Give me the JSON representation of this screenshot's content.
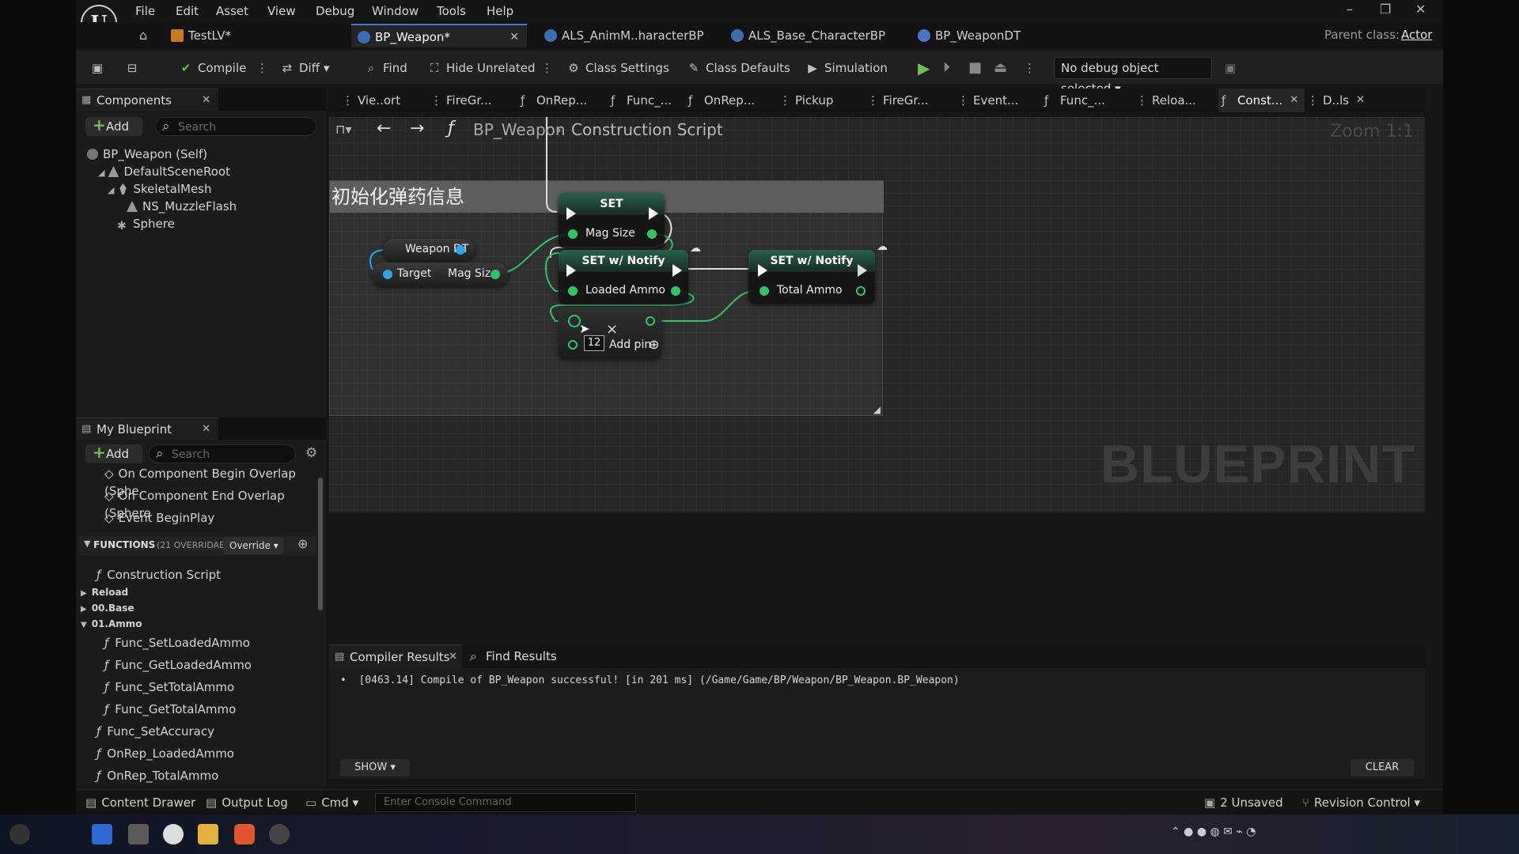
{
  "menu": [
    "File",
    "Edit",
    "Asset",
    "View",
    "Debug",
    "Window",
    "Tools",
    "Help"
  ],
  "doc_tabs": [
    {
      "label": "TestLV*"
    },
    {
      "label": "BP_Weapon*"
    },
    {
      "label": "ALS_AnimM..haracterBP"
    },
    {
      "label": "ALS_Base_CharacterBP"
    },
    {
      "label": "BP_WeaponDT"
    }
  ],
  "parent_class": {
    "label": "Parent class:",
    "value": "Actor"
  },
  "toolbar": {
    "compile": "Compile",
    "diff": "Diff",
    "find": "Find",
    "hide_unrelated": "Hide Unrelated",
    "class_settings": "Class Settings",
    "class_defaults": "Class Defaults",
    "simulation": "Simulation",
    "debug_object": "No debug object selected"
  },
  "components": {
    "tab": "Components",
    "add": "Add",
    "search_placeholder": "Search",
    "items": [
      "BP_Weapon (Self)",
      "DefaultSceneRoot",
      "SkeletalMesh",
      "NS_MuzzleFlash",
      "Sphere"
    ]
  },
  "graph_tabs": [
    "Vie..ort",
    "FireGr...",
    "OnRep...",
    "Func_...",
    "OnRep...",
    "Pickup",
    "FireGr...",
    "Event...",
    "Func_...",
    "Reloa...",
    "Const...",
    "D..ls"
  ],
  "breadcrumb": {
    "root": "BP_Weapon",
    "current": "Construction Script"
  },
  "zoom": "Zoom 1:1",
  "watermark": "BLUEPRINT",
  "comment_title": "初始化弹药信息",
  "nodes": {
    "weapon_dt": "Weapon DT",
    "target": "Target",
    "mag_size_out": "Mag Size",
    "set": "SET",
    "set_mag_size": "Mag Size",
    "set_notify_1": "SET w/ Notify",
    "loaded_ammo": "Loaded Ammo",
    "set_notify_2": "SET w/ Notify",
    "total_ammo": "Total Ammo",
    "multiply_value": "12",
    "add_pin": "Add pin"
  },
  "my_blueprint": {
    "tab": "My Blueprint",
    "add": "Add",
    "search_placeholder": "Search",
    "events": [
      "On Component Begin Overlap (Sphe",
      "On Component End Overlap (Sphere",
      "Event BeginPlay"
    ],
    "functions_header": "FUNCTIONS",
    "functions_count": "(21 OVERRIDABL",
    "override": "Override",
    "functions": [
      {
        "label": "Construction Script",
        "indent": 1
      },
      {
        "label": "Reload",
        "indent": 0,
        "category": true
      },
      {
        "label": "00.Base",
        "indent": 0,
        "category": true
      },
      {
        "label": "01.Ammo",
        "indent": 0,
        "category": true
      },
      {
        "label": "Func_SetLoadedAmmo",
        "indent": 2
      },
      {
        "label": "Func_GetLoadedAmmo",
        "indent": 2
      },
      {
        "label": "Func_SetTotalAmmo",
        "indent": 2
      },
      {
        "label": "Func_GetTotalAmmo",
        "indent": 2
      },
      {
        "label": "Func_SetAccuracy",
        "indent": 1
      },
      {
        "label": "OnRep_LoadedAmmo",
        "indent": 1
      },
      {
        "label": "OnRep_TotalAmmo",
        "indent": 1
      }
    ]
  },
  "bottom": {
    "compiler_tab": "Compiler Results",
    "find_tab": "Find Results",
    "log": "[0463.14] Compile of BP_Weapon successful! [in 201 ms] (/Game/Game/BP/Weapon/BP_Weapon.BP_Weapon)",
    "show": "SHOW",
    "clear": "CLEAR"
  },
  "status": {
    "content_drawer": "Content Drawer",
    "output_log": "Output Log",
    "cmd": "Cmd",
    "console_placeholder": "Enter Console Command",
    "unsaved": "2 Unsaved",
    "revision": "Revision Control"
  },
  "colors": {
    "accent": "#3a7bd5",
    "node_header": "#27614c",
    "pin_green": "#2ec46a",
    "pin_blue": "#2aa6e8"
  }
}
